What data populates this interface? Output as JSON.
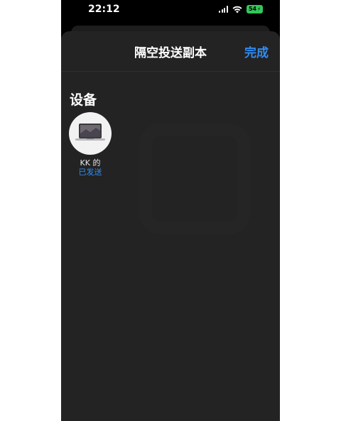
{
  "status_bar": {
    "time": "22:12",
    "battery": "54"
  },
  "sheet": {
    "title": "隔空投送副本",
    "done_label": "完成"
  },
  "section": {
    "title": "设备"
  },
  "devices": [
    {
      "name": "KK 的",
      "status": "已发送",
      "icon": "macbook-icon"
    }
  ],
  "colors": {
    "accent": "#2f8cf5",
    "sheet_bg": "#232323",
    "battery": "#34c759"
  }
}
